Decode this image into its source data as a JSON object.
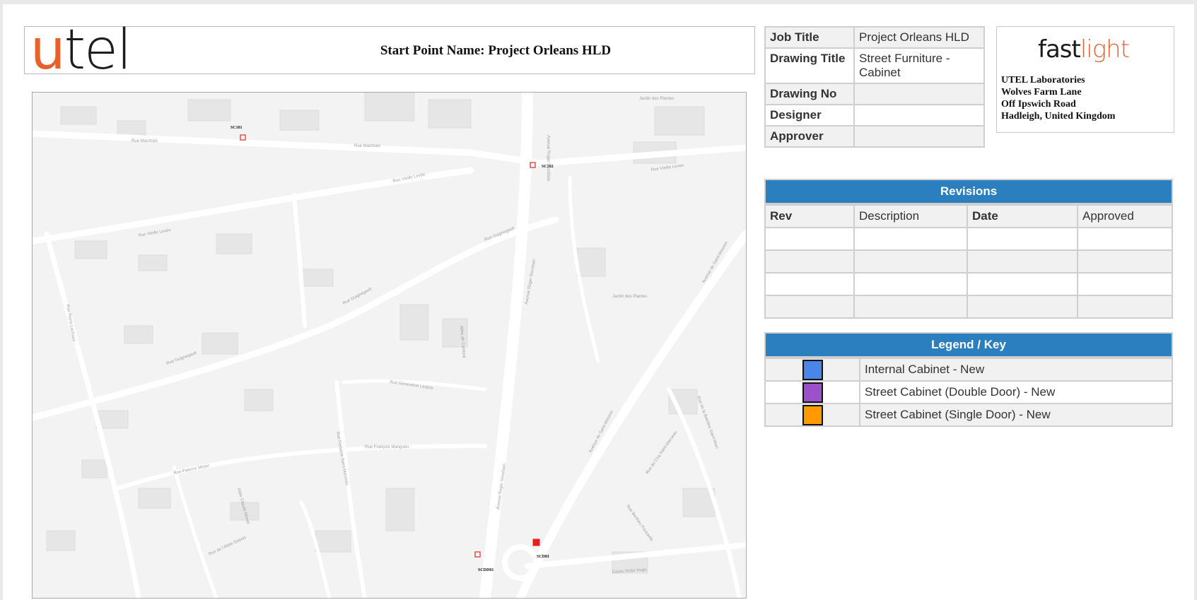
{
  "header": {
    "logo_u": "u",
    "logo_rest": "tel",
    "start_point": "Start Point Name: Project Orleans HLD"
  },
  "info": {
    "rows": [
      {
        "key": "Job Title",
        "value": "Project Orleans HLD"
      },
      {
        "key": "Drawing Title",
        "value": "Street Furniture - Cabinet"
      },
      {
        "key": "Drawing No",
        "value": ""
      },
      {
        "key": "Designer",
        "value": ""
      },
      {
        "key": "Approver",
        "value": ""
      }
    ]
  },
  "company": {
    "logo_fast": "fast",
    "logo_light": "light",
    "address": [
      "UTEL Laboratories",
      "Wolves Farm Lane",
      "Off Ipswich Road",
      "Hadleigh, United Kingdom"
    ]
  },
  "revisions": {
    "title": "Revisions",
    "columns": [
      "Rev",
      "Description",
      "Date",
      "Approved"
    ]
  },
  "legend": {
    "title": "Legend / Key",
    "items": [
      {
        "label": "Internal Cabinet - New",
        "color": "#4a86e8"
      },
      {
        "label": "Street Cabinet (Double Door) - New",
        "color": "#9b51c9"
      },
      {
        "label": "Street Cabinet (Single Door) - New",
        "color": "#ff9900"
      }
    ]
  },
  "map": {
    "markers": [
      "SC101",
      "SC102",
      "SCDD01",
      "SCD01"
    ],
    "streets": [
      "Rue Marchais",
      "Rue Vieille Levée",
      "Rue Guignegault",
      "Avenue Roger Secrétain",
      "Rue François Mangotin",
      "Rue Paterne Meyer",
      "Rue Geneviève Lespuy",
      "Allée de Cambrai",
      "Jardin des Plantes",
      "Avenue de Saint-Mesmin",
      "Rue du Coq Saint-Marceau",
      "Rue Pierre Lachoux",
      "Cours Victor Hugo",
      "Rue Bertheu Pousselle",
      "Rue de l'Abbé Dubois",
      "Rue Fontaine Saint-Marceau",
      "Rue de la Barrière Saint-Marc",
      "Avenue de Saint-Mesmin",
      "Allée Claude Monet"
    ]
  }
}
